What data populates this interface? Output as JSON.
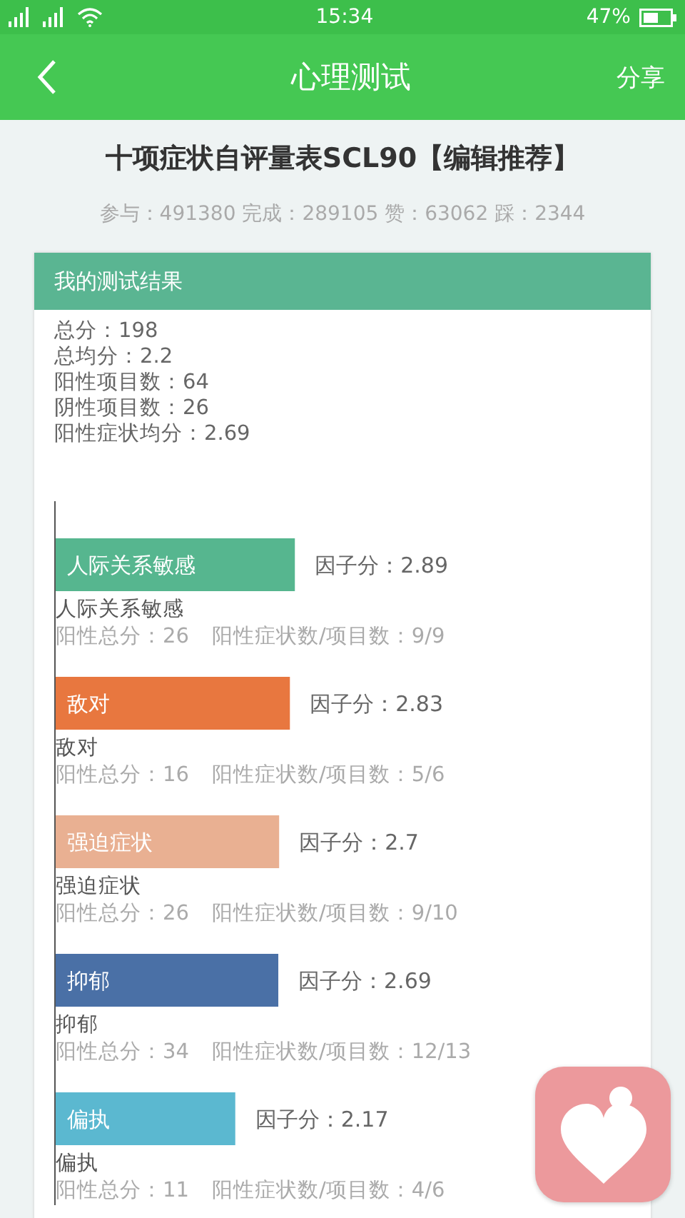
{
  "status_bar": {
    "time": "15:34",
    "battery": "47%"
  },
  "header": {
    "back_icon": true,
    "title": "心理测试",
    "share": "分享"
  },
  "test_title": "十项症状自评量表SCL90【编辑推荐】",
  "stats": "参与：491380 完成：289105 赞：63062 踩：2344",
  "result_card": {
    "title": "我的测试结果",
    "summary": [
      "总分：198",
      "总均分：2.2",
      "阳性项目数：64",
      "阴性项目数：26",
      "阳性症状均分：2.69"
    ],
    "chart_data": {
      "type": "bar",
      "orientation": "horizontal",
      "categories": [
        "人际关系敏感",
        "敌对",
        "强迫症状",
        "抑郁",
        "偏执"
      ],
      "values": [
        2.89,
        2.83,
        2.7,
        2.69,
        2.17
      ],
      "value_labels": [
        "因子分：2.89",
        "因子分：2.83",
        "因子分：2.7",
        "因子分：2.69",
        "因子分：2.17"
      ]
    },
    "factors": [
      {
        "color": "#56b68f",
        "name": "人际关系敏感",
        "positive_total": "阳性总分：26",
        "ratio": "阳性症状数/项目数：9/9"
      },
      {
        "color": "#e8773f",
        "name": "敌对",
        "positive_total": "阳性总分：16",
        "ratio": "阳性症状数/项目数：5/6"
      },
      {
        "color": "#e9b092",
        "name": "强迫症状",
        "positive_total": "阳性总分：26",
        "ratio": "阳性症状数/项目数：9/10"
      },
      {
        "color": "#4a70a6",
        "name": "抑郁",
        "positive_total": "阳性总分：34",
        "ratio": "阳性症状数/项目数：12/13"
      },
      {
        "color": "#5bb8d0",
        "name": "偏执",
        "positive_total": "阳性总分：11",
        "ratio": "阳性症状数/项目数：4/6"
      }
    ]
  }
}
